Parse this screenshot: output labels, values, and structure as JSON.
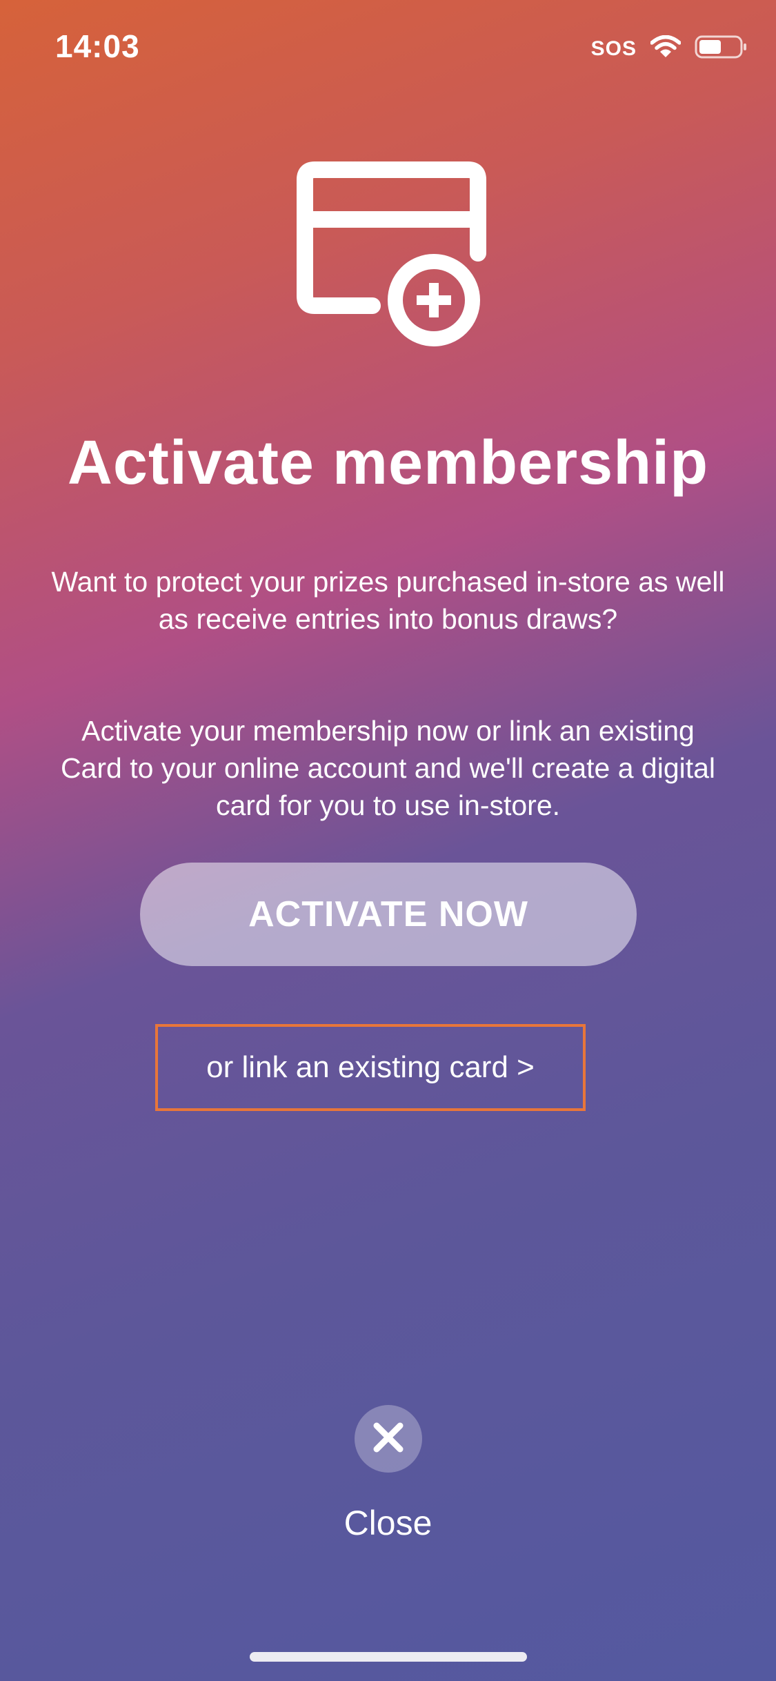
{
  "status_bar": {
    "time": "14:03",
    "carrier": "SOS",
    "wifi_icon": "wifi-icon",
    "battery_icon": "battery-icon",
    "battery_level_fraction": 0.55
  },
  "hero": {
    "icon": "card-add-icon"
  },
  "title": "Activate membership",
  "body": {
    "paragraph_1": "Want to protect your prizes purchased in-store as well as receive entries into bonus draws?",
    "paragraph_2": "Activate your membership now or link an existing Card to your online account and we'll create a digital card for you to use in-store."
  },
  "actions": {
    "activate_label": "ACTIVATE NOW",
    "link_card_label": "or link an existing card >",
    "close_icon": "close-icon",
    "close_label": "Close"
  },
  "colors": {
    "gradient_top": "#d6623a",
    "gradient_mid": "#b04f85",
    "gradient_bottom": "#5459a0",
    "highlight_border": "#e8763a"
  }
}
